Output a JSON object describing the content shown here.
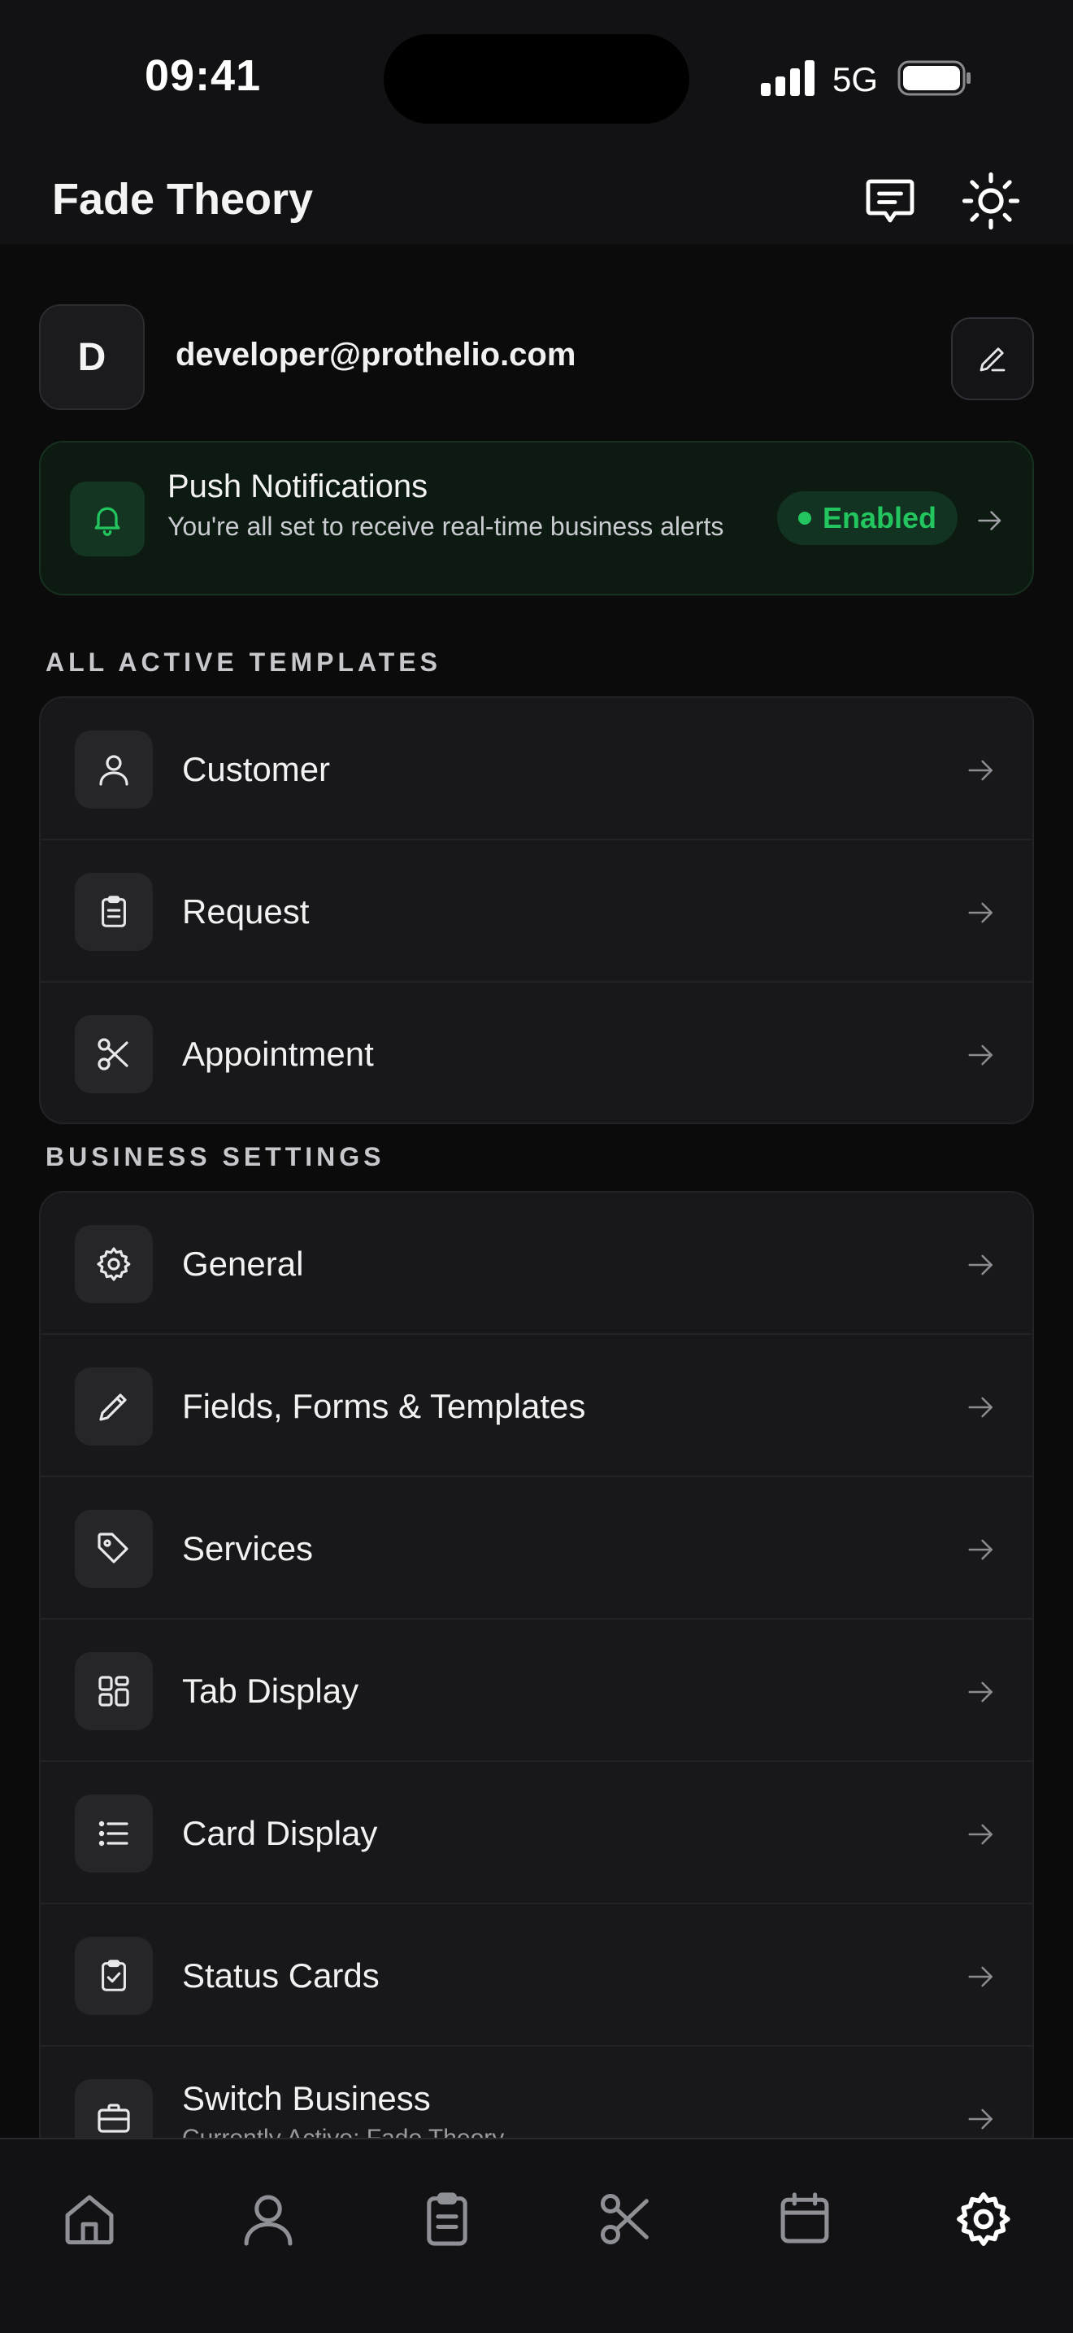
{
  "status_bar": {
    "time": "09:41",
    "network": "5G"
  },
  "header": {
    "title": "Fade Theory"
  },
  "profile": {
    "initial": "D",
    "email": "developer@prothelio.com"
  },
  "notification": {
    "title": "Push Notifications",
    "subtitle": "You're all set to receive real-time business alerts",
    "status": "Enabled",
    "status_color": "#22c55e"
  },
  "templates_section": {
    "title": "ALL ACTIVE TEMPLATES",
    "items": [
      {
        "label": "Customer",
        "icon": "user-icon"
      },
      {
        "label": "Request",
        "icon": "clipboard-icon"
      },
      {
        "label": "Appointment",
        "icon": "scissors-icon"
      }
    ]
  },
  "business_section": {
    "title": "BUSINESS SETTINGS",
    "items": [
      {
        "label": "General",
        "icon": "gear-icon"
      },
      {
        "label": "Fields, Forms & Templates",
        "icon": "pencil-icon"
      },
      {
        "label": "Services",
        "icon": "tag-icon"
      },
      {
        "label": "Tab Display",
        "icon": "layout-grid-icon"
      },
      {
        "label": "Card Display",
        "icon": "list-icon"
      },
      {
        "label": "Status Cards",
        "icon": "clipboard-check-icon"
      },
      {
        "label": "Switch Business",
        "subtitle": "Currently Active: Fade Theory",
        "icon": "briefcase-icon"
      }
    ]
  },
  "tab_bar": {
    "items": [
      "home-icon",
      "user-icon",
      "clipboard-icon",
      "scissors-icon",
      "calendar-icon",
      "gear-icon"
    ],
    "active": "gear-icon",
    "active_color": "#ffffff",
    "inactive_color": "#8e9096"
  }
}
